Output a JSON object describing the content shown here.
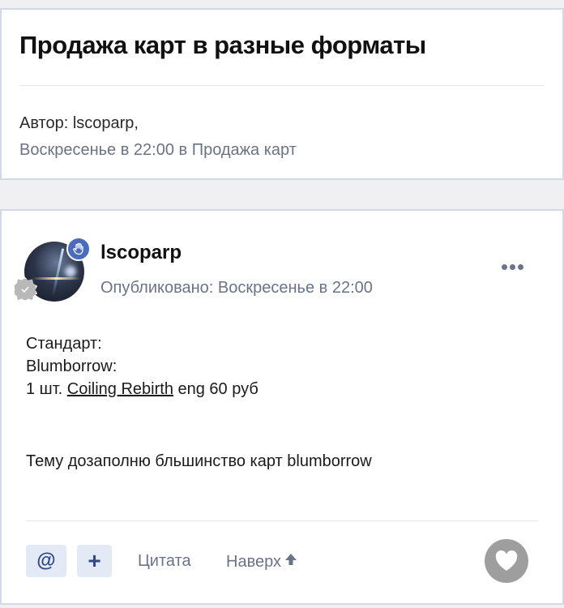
{
  "topic": {
    "title": "Продажа карт в разные форматы",
    "author_line": "Автор: lscoparp,",
    "date_line": "Воскресенье в 22:00 в Продажа карт"
  },
  "post": {
    "author": "lscoparp",
    "published": "Опубликовано: Воскресенье в 22:00",
    "body": {
      "line1": "Стандарт:",
      "line2": "Blumborrow:",
      "line3_prefix": "1 шт. ",
      "line3_link": "Coiling Rebirth",
      "line3_suffix": " eng 60 руб",
      "line4": "Тему дозаполню бльшинство карт blumborrow"
    },
    "actions": {
      "mention_label": "@",
      "plus_label": "+",
      "quote_label": "Цитата",
      "up_label": "Наверх"
    }
  },
  "icons": {
    "more": "more-horizontal-icon",
    "like": "heart-icon",
    "up_arrow": "arrow-up-icon",
    "moderator_badge": "hand-badge-icon",
    "rank_badge": "rank-badge-icon"
  },
  "colors": {
    "accent": "#4b6bbf",
    "muted_text": "#6b7389",
    "button_bg": "#e3eaf6",
    "like_bg": "#9e9e9e"
  }
}
